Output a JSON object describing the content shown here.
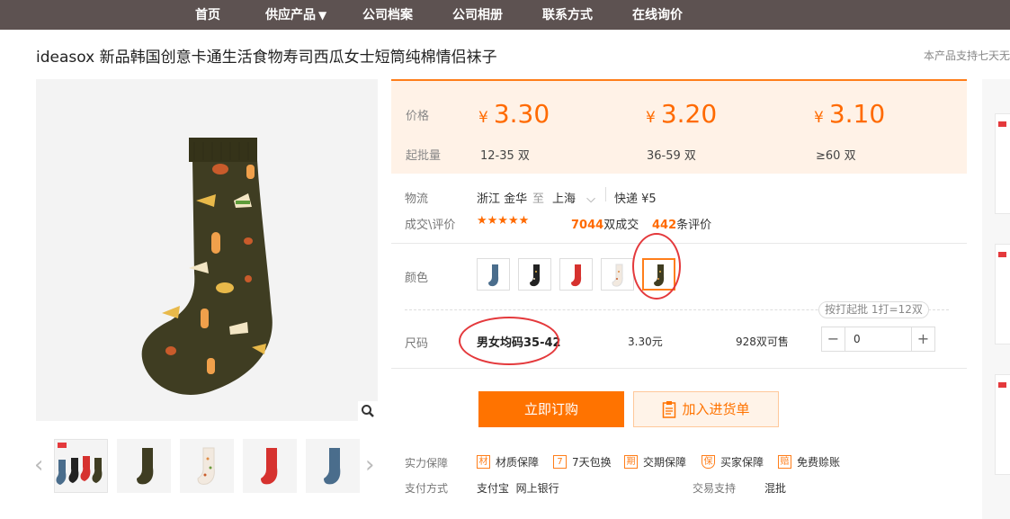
{
  "nav": {
    "items": [
      "首页",
      "供应产品",
      "公司档案",
      "公司相册",
      "联系方式",
      "在线询价"
    ],
    "caret": "▼"
  },
  "product": {
    "title": "ideasox 新品韩国创意卡通生活食物寿司西瓜女士短筒纯棉情侣袜子",
    "notice": "本产品支持七天无"
  },
  "pricing": {
    "price_label": "价格",
    "qty_label": "起批量",
    "currency": "¥",
    "tiers": [
      {
        "price": "3.30",
        "qty": "12-35 双"
      },
      {
        "price": "3.20",
        "qty": "36-59 双"
      },
      {
        "price": "3.10",
        "qty": "≥60 双"
      }
    ]
  },
  "logistics": {
    "label": "物流",
    "from": "浙江 金华",
    "to_word": "至",
    "to": "上海",
    "express": "快递 ¥5"
  },
  "deals": {
    "label": "成交\\评价",
    "stars": "★★★★★",
    "count": "7044",
    "count_suffix": "双成交",
    "reviews": "442",
    "reviews_suffix": "条评价"
  },
  "color": {
    "label": "颜色",
    "options": [
      "blue-sock",
      "black-sock",
      "red-sock",
      "white-sock",
      "olive-sock"
    ],
    "selected_index": 4
  },
  "size": {
    "label": "尺码",
    "value": "男女均码35-42",
    "price": "3.30元",
    "stock": "928双可售",
    "quantity": "0",
    "batch_note": "按打起批 1打=12双"
  },
  "actions": {
    "buy": "立即订购",
    "cart": "加入进货单"
  },
  "guarantee": {
    "label": "实力保障",
    "items": [
      {
        "icon": "材",
        "text": "材质保障"
      },
      {
        "icon": "7",
        "text": "7天包换"
      },
      {
        "icon": "期",
        "text": "交期保障"
      },
      {
        "icon": "保",
        "text": "买家保障"
      },
      {
        "icon": "赔",
        "text": "免费赊账"
      }
    ]
  },
  "payment": {
    "label": "支付方式",
    "methods": "支付宝  网上银行",
    "trade_label": "交易支持",
    "trade_value": "混批"
  },
  "colors": {
    "nav_bg": "#5d5251",
    "accent": "#ff7300",
    "price_bg": "#fff2e7",
    "annotation": "#e4393c",
    "sock_olive": "#3f3d22"
  }
}
